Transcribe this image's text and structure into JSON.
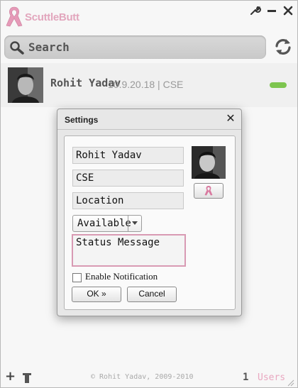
{
  "app": {
    "title": "ScuttleButt",
    "accent_color": "#e9a7c0",
    "window_controls": [
      "wrench-icon",
      "minimize-icon",
      "close-icon"
    ]
  },
  "search": {
    "placeholder": "Search"
  },
  "users": [
    {
      "name": "Rohit Yadav",
      "meta": "10.9.20.18 | CSE",
      "status_color": "#7dc54f"
    }
  ],
  "footer": {
    "copyright": "© Rohit Yadav, 2009-2010",
    "count": "1",
    "users_label": "Users"
  },
  "settings_dialog": {
    "title": "Settings",
    "name_value": "Rohit Yadav",
    "group_value": "CSE",
    "location_value": "Location",
    "status_selected": "Available",
    "status_message_value": "Status Message",
    "notification_label": "Enable Notification",
    "notification_checked": false,
    "ok_label": "OK »",
    "cancel_label": "Cancel"
  }
}
